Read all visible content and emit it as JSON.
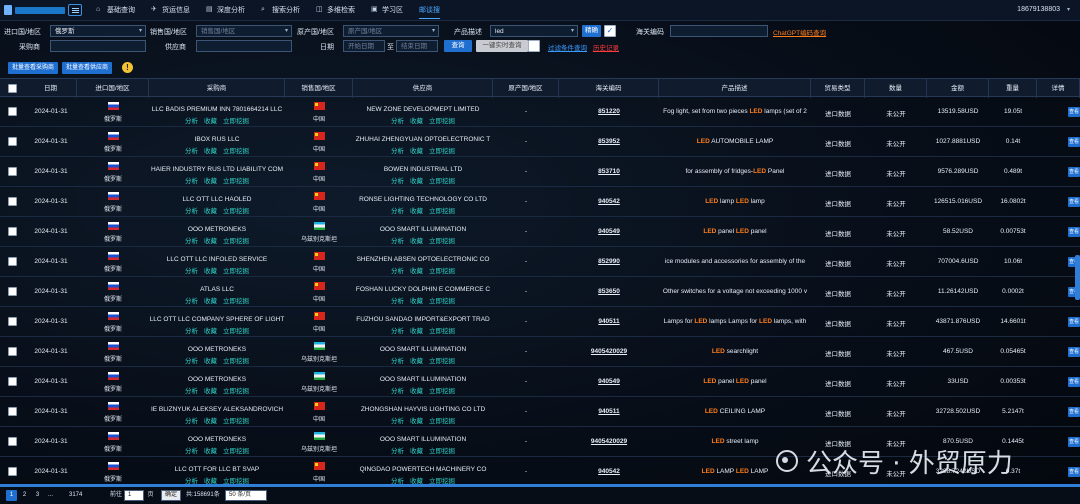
{
  "nav": {
    "items": [
      {
        "icon": "home-icon",
        "label": "基础查询"
      },
      {
        "icon": "plane-icon",
        "label": "货运信息"
      },
      {
        "icon": "chart-icon",
        "label": "深度分析"
      },
      {
        "icon": "search-icon",
        "label": "搜索分析"
      },
      {
        "icon": "layers-icon",
        "label": "多维检索"
      },
      {
        "icon": "book-icon",
        "label": "学习区"
      },
      {
        "icon": "",
        "label": "邮谈搜"
      }
    ],
    "phone": "18679138803"
  },
  "filters": {
    "import_region_label": "进口国/地区",
    "import_region_value": "俄罗斯",
    "sales_region_label": "销售国/地区",
    "sales_region_placeholder": "销售国/地区",
    "origin_label": "原产国/地区",
    "origin_placeholder": "原产国/地区",
    "product_label": "产品描述",
    "product_value": "led",
    "exact_label": "精确",
    "hs_label": "海关编码",
    "gpt_link": "ChatGPT编码查询",
    "buyer_label": "采购商",
    "supplier_label": "供应商",
    "date_label": "日期",
    "date_start_placeholder": "开始日期",
    "date_sep": "至",
    "date_end_placeholder": "结束日期",
    "query_button": "查询",
    "realtime_button": "一键实时查询",
    "filter_link": "过滤条件查询",
    "history_link": "历史记录"
  },
  "toolbar": {
    "batch_buyer": "批量查看采购商",
    "batch_supplier": "批量查看供应商",
    "warn": "!"
  },
  "table": {
    "headers": [
      "日期",
      "进口国/地区",
      "采购商",
      "销售国/地区",
      "供应商",
      "原产国/地区",
      "海关编码",
      "产品描述",
      "贸易类型",
      "数量",
      "金额",
      "重量",
      "详情"
    ],
    "actions": [
      "分析",
      "收藏",
      "立即挖掘"
    ],
    "rows": [
      {
        "date": "2024-01-31",
        "import": "俄罗斯",
        "buyer": "LLC BADIS PREMIUM INN 7801664214 LLC",
        "sales": "中国",
        "sales_flag": "cn",
        "supplier": "NEW ZONE DEVELOPMEPT LIMITED",
        "origin": "-",
        "hs": "851220",
        "desc": [
          "Fog light, set from two pieces ",
          "LED",
          " lamps (set of 2"
        ],
        "trade": "进口数据",
        "qty": "未公开",
        "amount": "13519.58USD",
        "weight": "19.05t"
      },
      {
        "date": "2024-01-31",
        "import": "俄罗斯",
        "buyer": "IBOX RUS LLC",
        "sales": "中国",
        "sales_flag": "cn",
        "supplier": "ZHUHAI ZHENGYUAN OPTOELECTRONIC T",
        "origin": "-",
        "hs": "853952",
        "desc": [
          "",
          "LED",
          " AUTOMOBILE LAMP"
        ],
        "trade": "进口数据",
        "qty": "未公开",
        "amount": "1027.8881USD",
        "weight": "0.14t"
      },
      {
        "date": "2024-01-31",
        "import": "俄罗斯",
        "buyer": "HAIER INDUSTRY RUS LTD LIABILITY COM",
        "sales": "中国",
        "sales_flag": "cn",
        "supplier": "BOWEN INDUSTRIAL LTD",
        "origin": "-",
        "hs": "853710",
        "desc": [
          "for assembly of fridges-",
          "LED",
          " Panel"
        ],
        "trade": "进口数据",
        "qty": "未公开",
        "amount": "9576.289USD",
        "weight": "0.489t"
      },
      {
        "date": "2024-01-31",
        "import": "俄罗斯",
        "buyer": "LLC OTT LLC HAOLED",
        "sales": "中国",
        "sales_flag": "cn",
        "supplier": "RONSE LIGHTING TECHNOLOGY CO LTD",
        "origin": "-",
        "hs": "940542",
        "desc": [
          "",
          "LED",
          " lamp ",
          "LED",
          " lamp"
        ],
        "trade": "进口数据",
        "qty": "未公开",
        "amount": "126515.016USD",
        "weight": "16.0802t"
      },
      {
        "date": "2024-01-31",
        "import": "俄罗斯",
        "buyer": "OOO METRONEKS",
        "sales": "乌兹别克斯坦",
        "sales_flag": "uz",
        "supplier": "OOO SMART ILLUMINATION",
        "origin": "-",
        "hs": "940549",
        "desc": [
          "",
          "LED",
          " panel ",
          "LED",
          " panel"
        ],
        "trade": "进口数据",
        "qty": "未公开",
        "amount": "58.52USD",
        "weight": "0.00753t"
      },
      {
        "date": "2024-01-31",
        "import": "俄罗斯",
        "buyer": "LLC OTT LLC INFOLED SERVICE",
        "sales": "中国",
        "sales_flag": "cn",
        "supplier": "SHENZHEN ABSEN OPTOELECTRONIC CO",
        "origin": "-",
        "hs": "852990",
        "desc": [
          "ice modules and accessories for assembly of the",
          ""
        ],
        "trade": "进口数据",
        "qty": "未公开",
        "amount": "707004.6USD",
        "weight": "10.06t"
      },
      {
        "date": "2024-01-31",
        "import": "俄罗斯",
        "buyer": "ATLAS LLC",
        "sales": "中国",
        "sales_flag": "cn",
        "supplier": "FOSHAN LUCKY DOLPHIN E COMMERCE C",
        "origin": "-",
        "hs": "853650",
        "desc": [
          "Other switches for a voltage not exceeding 1000 v",
          ""
        ],
        "trade": "进口数据",
        "qty": "未公开",
        "amount": "11.26142USD",
        "weight": "0.0002t"
      },
      {
        "date": "2024-01-31",
        "import": "俄罗斯",
        "buyer": "LLC OTT LLC COMPANY SPHERE OF LIGHT",
        "sales": "中国",
        "sales_flag": "cn",
        "supplier": "FUZHOU SANDAO IMPORT&EXPORT TRAD",
        "origin": "-",
        "hs": "940511",
        "desc": [
          "Lamps for ",
          "LED",
          " lamps Lamps for ",
          "LED",
          " lamps, with"
        ],
        "trade": "进口数据",
        "qty": "未公开",
        "amount": "43871.876USD",
        "weight": "14.6601t"
      },
      {
        "date": "2024-01-31",
        "import": "俄罗斯",
        "buyer": "OOO METRONEKS",
        "sales": "乌兹别克斯坦",
        "sales_flag": "uz",
        "supplier": "OOO SMART ILLUMINATION",
        "origin": "-",
        "hs": "9405420029",
        "desc": [
          "",
          "LED",
          " searchlight"
        ],
        "trade": "进口数据",
        "qty": "未公开",
        "amount": "467.5USD",
        "weight": "0.05465t"
      },
      {
        "date": "2024-01-31",
        "import": "俄罗斯",
        "buyer": "OOO METRONEKS",
        "sales": "乌兹别克斯坦",
        "sales_flag": "uz",
        "supplier": "OOO SMART ILLUMINATION",
        "origin": "-",
        "hs": "940549",
        "desc": [
          "",
          "LED",
          " panel ",
          "LED",
          " panel"
        ],
        "trade": "进口数据",
        "qty": "未公开",
        "amount": "33USD",
        "weight": "0.00353t"
      },
      {
        "date": "2024-01-31",
        "import": "俄罗斯",
        "buyer": "IE BLIZNYUK ALEKSEY ALEKSANDROVICH",
        "sales": "中国",
        "sales_flag": "cn",
        "supplier": "ZHONGSHAN HAYVIS LIGHTING CO LTD",
        "origin": "-",
        "hs": "940511",
        "desc": [
          "",
          "LED",
          " CEILING LAMP"
        ],
        "trade": "进口数据",
        "qty": "未公开",
        "amount": "32728.502USD",
        "weight": "5.2147t"
      },
      {
        "date": "2024-01-31",
        "import": "俄罗斯",
        "buyer": "OOO METRONEKS",
        "sales": "乌兹别克斯坦",
        "sales_flag": "uz",
        "supplier": "OOO SMART ILLUMINATION",
        "origin": "-",
        "hs": "9405420029",
        "desc": [
          "",
          "LED",
          " street lamp"
        ],
        "trade": "进口数据",
        "qty": "未公开",
        "amount": "870.5USD",
        "weight": "0.1445t"
      },
      {
        "date": "2024-01-31",
        "import": "俄罗斯",
        "buyer": "LLC OTT FOR LLC BT SVAP",
        "sales": "中国",
        "sales_flag": "cn",
        "supplier": "QINGDAO POWERTECH MACHINERY CO",
        "origin": "-",
        "hs": "940542",
        "desc": [
          "",
          "LED",
          " LAMP ",
          "LED",
          " LAMP"
        ],
        "trade": "进口数据",
        "qty": "未公开",
        "amount": "3288.7242USD",
        "weight": "0.37t"
      }
    ],
    "detail_label": "查看"
  },
  "pagination": {
    "pages": [
      "1",
      "2",
      "3",
      "...",
      "3174"
    ],
    "goto_label": "前往",
    "goto_value": "1",
    "page_unit": "页",
    "confirm": "确定",
    "total": "共:158691条",
    "page_size": "50 条/页"
  },
  "watermark": "公众号 · 外贸原力"
}
